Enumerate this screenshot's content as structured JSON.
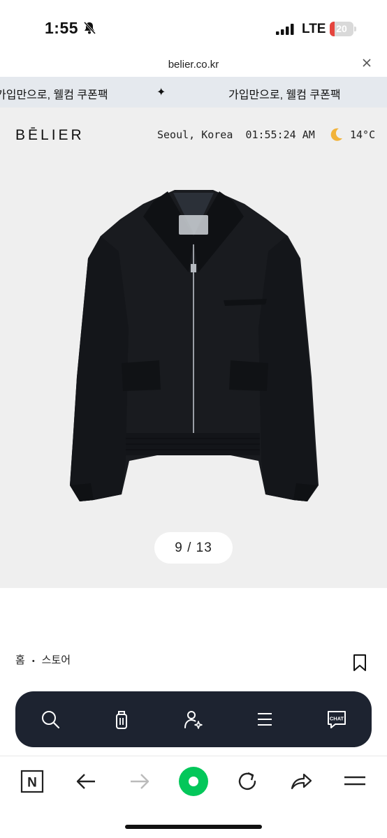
{
  "status_bar": {
    "time": "1:55",
    "network": "LTE",
    "battery": "20",
    "battery_level": 0.2,
    "silent_icon": "bell-slash-icon",
    "signal_icon": "signal-bars-icon"
  },
  "browser": {
    "url": "belier.co.kr",
    "close_icon": "close-icon"
  },
  "announcement": {
    "messages": [
      "가입만으로, 웰컴 쿠폰팩",
      "가입만으로, 웰컴 쿠폰팩"
    ],
    "separator": "✦"
  },
  "header": {
    "logo": "BĒLIER",
    "location": "Seoul, Korea",
    "clock": "01:55:24 AM",
    "weather_icon": "crescent-moon-icon",
    "temperature": "14°C"
  },
  "gallery": {
    "current": "9",
    "total": "13",
    "counter_text": "9 / 13",
    "background": "#efefef"
  },
  "breadcrumb": {
    "items": [
      "홈",
      "스토어"
    ],
    "separator": "•"
  },
  "floating_nav": {
    "items": [
      {
        "icon": "search-icon"
      },
      {
        "icon": "shopping-bag-icon"
      },
      {
        "icon": "user-sparkle-icon"
      },
      {
        "icon": "menu-icon"
      },
      {
        "icon": "chat-icon",
        "label": "CHAT"
      }
    ],
    "background": "#1d2330"
  },
  "browser_toolbar": {
    "items": [
      {
        "icon": "naver-n-icon",
        "label": "N"
      },
      {
        "icon": "back-arrow-icon"
      },
      {
        "icon": "forward-arrow-icon"
      },
      {
        "icon": "green-home-circle-icon"
      },
      {
        "icon": "reload-icon"
      },
      {
        "icon": "share-icon"
      },
      {
        "icon": "hamburger-menu-icon"
      }
    ],
    "accent": "#03c75a"
  }
}
